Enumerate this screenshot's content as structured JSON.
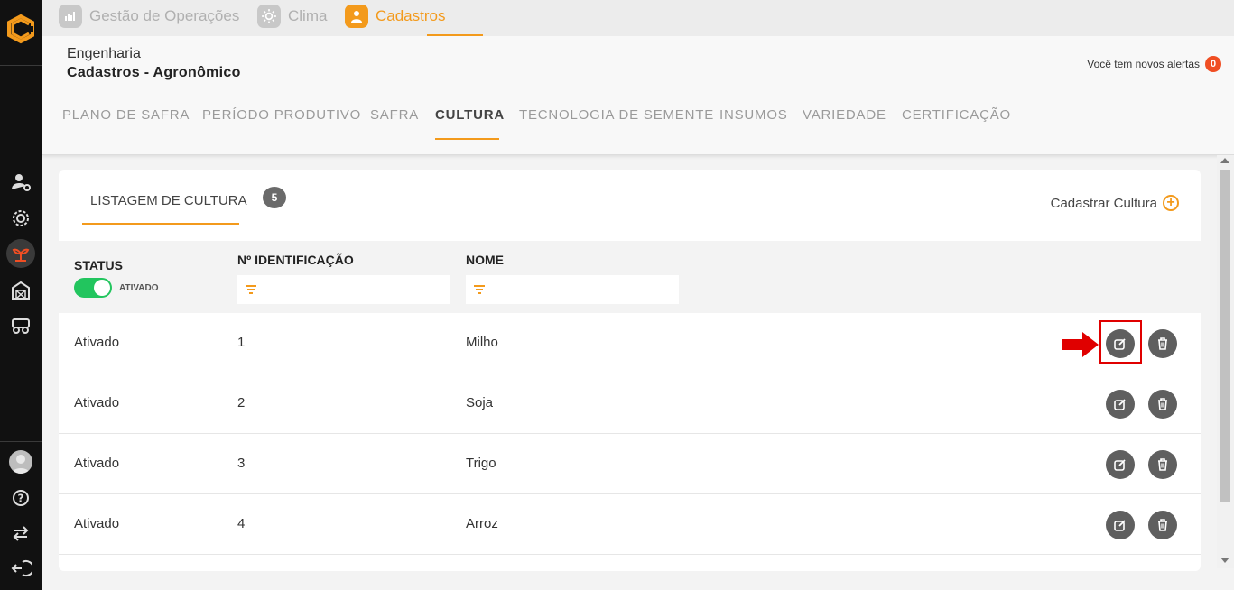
{
  "top_tabs": [
    {
      "label": "Gestão de Operações",
      "icon": "chart-hand-icon",
      "active": false
    },
    {
      "label": "Clima",
      "icon": "sun-icon",
      "active": false
    },
    {
      "label": "Cadastros",
      "icon": "user-icon",
      "active": true
    }
  ],
  "header": {
    "breadcrumb_parent": "Engenharia",
    "page_title": "Cadastros - Agronômico",
    "alerts_label": "Você tem novos alertas",
    "alerts_count": "0"
  },
  "nav_tabs": [
    {
      "label": "PLANO DE SAFRA",
      "active": false
    },
    {
      "label": "PERÍODO PRODUTIVO",
      "active": false
    },
    {
      "label": "SAFRA",
      "active": false
    },
    {
      "label": "CULTURA",
      "active": true
    },
    {
      "label": "TECNOLOGIA DE SEMENTE",
      "active": false
    },
    {
      "label": "INSUMOS",
      "active": false
    },
    {
      "label": "VARIEDADE",
      "active": false
    },
    {
      "label": "CERTIFICAÇÃO",
      "active": false
    }
  ],
  "card": {
    "tab_label": "LISTAGEM DE CULTURA",
    "count": "5",
    "add_label": "Cadastrar Cultura"
  },
  "table": {
    "headers": {
      "status": "STATUS",
      "id": "Nº IDENTIFICAÇÃO",
      "name": "NOME"
    },
    "status_toggle_label": "ATIVADO",
    "status_toggle_on": true,
    "rows": [
      {
        "status": "Ativado",
        "id": "1",
        "name": "Milho"
      },
      {
        "status": "Ativado",
        "id": "2",
        "name": "Soja"
      },
      {
        "status": "Ativado",
        "id": "3",
        "name": "Trigo"
      },
      {
        "status": "Ativado",
        "id": "4",
        "name": "Arroz"
      }
    ]
  },
  "colors": {
    "accent": "#f39a1c",
    "sidebar": "#111111",
    "toggle_on": "#22c55e",
    "alert": "#f04e23",
    "highlight": "#e00000"
  },
  "sidebar_icons": [
    "user-settings-icon",
    "gear-target-icon",
    "crop-icon",
    "barn-icon",
    "tractor-icon",
    "help-icon",
    "swap-icon",
    "logout-icon"
  ]
}
